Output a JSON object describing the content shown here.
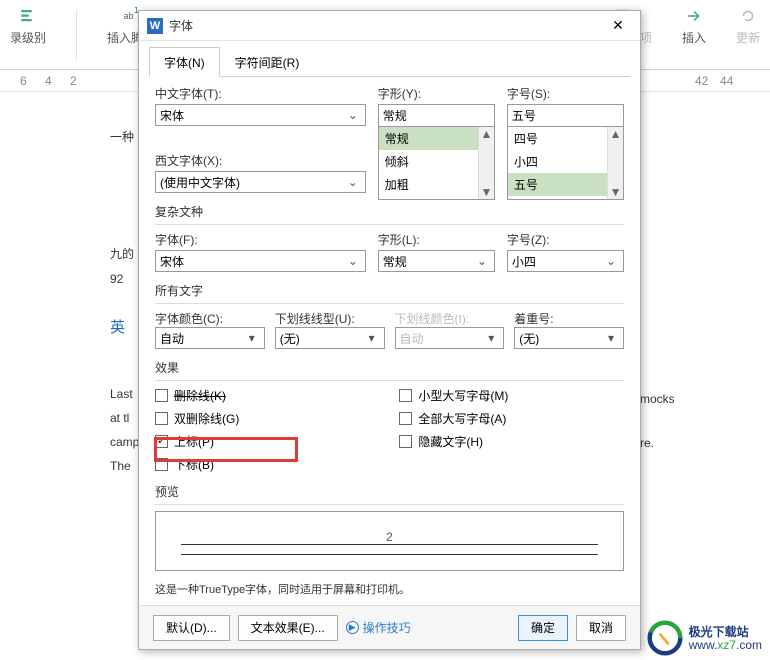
{
  "ribbon": {
    "item1": "录级别",
    "item2": "插入脚注",
    "item3": "标记索引项",
    "item4": "插入",
    "item5": "更新"
  },
  "ruler": {
    "m1": "6",
    "m2": "4",
    "m3": "2",
    "m4": "42",
    "m5": "44"
  },
  "docText": {
    "l1": "一种",
    "l2": "九的",
    "l3": "92",
    "l4": "英",
    "l5": "Last",
    "l6": "at tl",
    "l7": "campu",
    "l8": "The ",
    "r1": "mocks",
    "r2": "re."
  },
  "dialog": {
    "title": "字体",
    "tabs": {
      "font": "字体(N)",
      "spacing": "字符间距(R)"
    },
    "cnFont": {
      "label": "中文字体(T):",
      "value": "宋体"
    },
    "style": {
      "label": "字形(Y):",
      "value": "常规",
      "opts": [
        "常规",
        "倾斜",
        "加粗"
      ]
    },
    "size": {
      "label": "字号(S):",
      "value": "五号",
      "opts": [
        "四号",
        "小四",
        "五号"
      ]
    },
    "westFont": {
      "label": "西文字体(X):",
      "value": "(使用中文字体)"
    },
    "complex": {
      "title": "复杂文种",
      "font": {
        "label": "字体(F):",
        "value": "宋体"
      },
      "style": {
        "label": "字形(L):",
        "value": "常规"
      },
      "size": {
        "label": "字号(Z):",
        "value": "小四"
      }
    },
    "allText": {
      "title": "所有文字",
      "color": {
        "label": "字体颜色(C):",
        "value": "自动"
      },
      "underline": {
        "label": "下划线线型(U):",
        "value": "(无)"
      },
      "ulColor": {
        "label": "下划线颜色(I):",
        "value": "自动"
      },
      "emphasis": {
        "label": "着重号:",
        "value": "(无)"
      }
    },
    "effects": {
      "title": "效果",
      "strike": "删除线(K)",
      "dblStrike": "双删除线(G)",
      "superscript": "上标(P)",
      "subscript": "下标(B)",
      "smallCaps": "小型大写字母(M)",
      "allCaps": "全部大写字母(A)",
      "hidden": "隐藏文字(H)"
    },
    "preview": {
      "title": "预览",
      "sample": "2"
    },
    "desc": "这是一种TrueType字体，同时适用于屏幕和打印机。",
    "footer": {
      "default": "默认(D)...",
      "textEffects": "文本效果(E)...",
      "tips": "操作技巧",
      "ok": "确定",
      "cancel": "取消"
    }
  },
  "watermark": {
    "cn": "极光下载站",
    "domain": "www.xz7.com"
  }
}
